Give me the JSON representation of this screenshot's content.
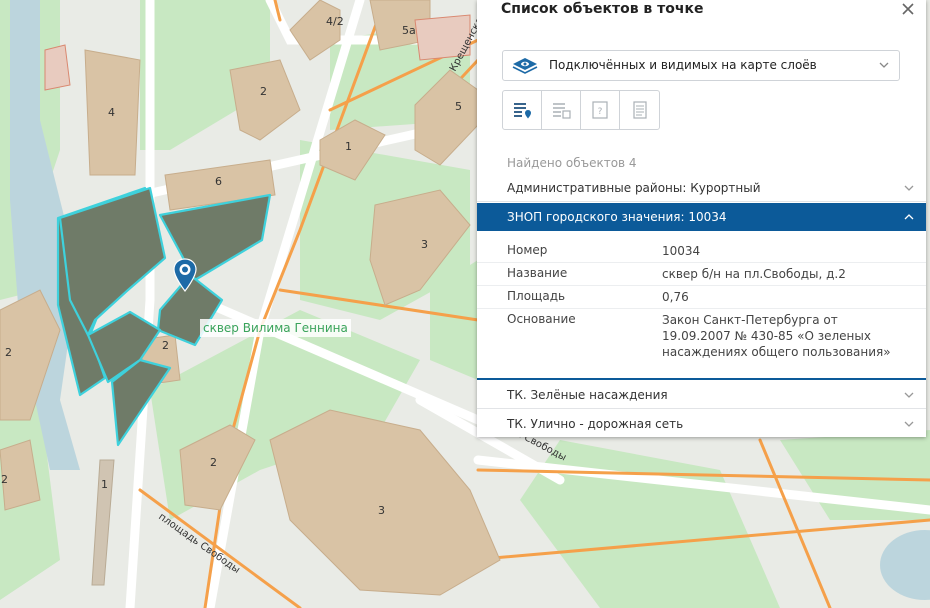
{
  "map": {
    "park_label": "сквер Вилима Геннина",
    "building_numbers": [
      "4/2",
      "5а",
      "2",
      "4",
      "6",
      "1",
      "5",
      "3",
      "2",
      "2",
      "2",
      "3",
      "1",
      "2",
      "2"
    ],
    "street_labels": [
      "Крещенская",
      "площадь Свободы",
      "ок Свободы"
    ],
    "colors": {
      "background": "#e9ebe6",
      "green": "#c8e8c2",
      "building": "#d9c3a5",
      "road_orange": "#f5a04a",
      "water": "#bcd5dd",
      "parcel_fill": "#6f7b68",
      "parcel_outline": "#3ed1dc"
    }
  },
  "panel": {
    "title": "Список объектов в точке",
    "close_icon": "close-icon",
    "layer_select": {
      "icon": "layers-icon",
      "selected": "Подключённых и видимых на карте слоёв"
    },
    "view_buttons": [
      {
        "name": "list-pin-icon",
        "active": true
      },
      {
        "name": "table-list-icon",
        "active": false
      },
      {
        "name": "unknown-doc-icon",
        "active": false
      },
      {
        "name": "document-icon",
        "active": false
      }
    ],
    "found_text": "Найдено объектов 4",
    "sections": [
      {
        "label": "Административные районы: Курортный",
        "expanded": false
      },
      {
        "label": "ЗНОП городского значения: 10034",
        "expanded": true
      },
      {
        "label": "ТК. Зелёные насаждения",
        "expanded": false
      },
      {
        "label": "ТК. Улично - дорожная сеть",
        "expanded": false
      }
    ],
    "attributes": [
      {
        "key": "Номер",
        "value": "10034"
      },
      {
        "key": "Название",
        "value": "сквер б/н на пл.Свободы, д.2"
      },
      {
        "key": "Площадь",
        "value": "0,76"
      },
      {
        "key": "Основание",
        "value": "Закон Санкт-Петербурга от 19.09.2007 № 430-85 «О зеленых насаждениях общего пользования»"
      }
    ],
    "accent_color": "#0c5a99"
  }
}
